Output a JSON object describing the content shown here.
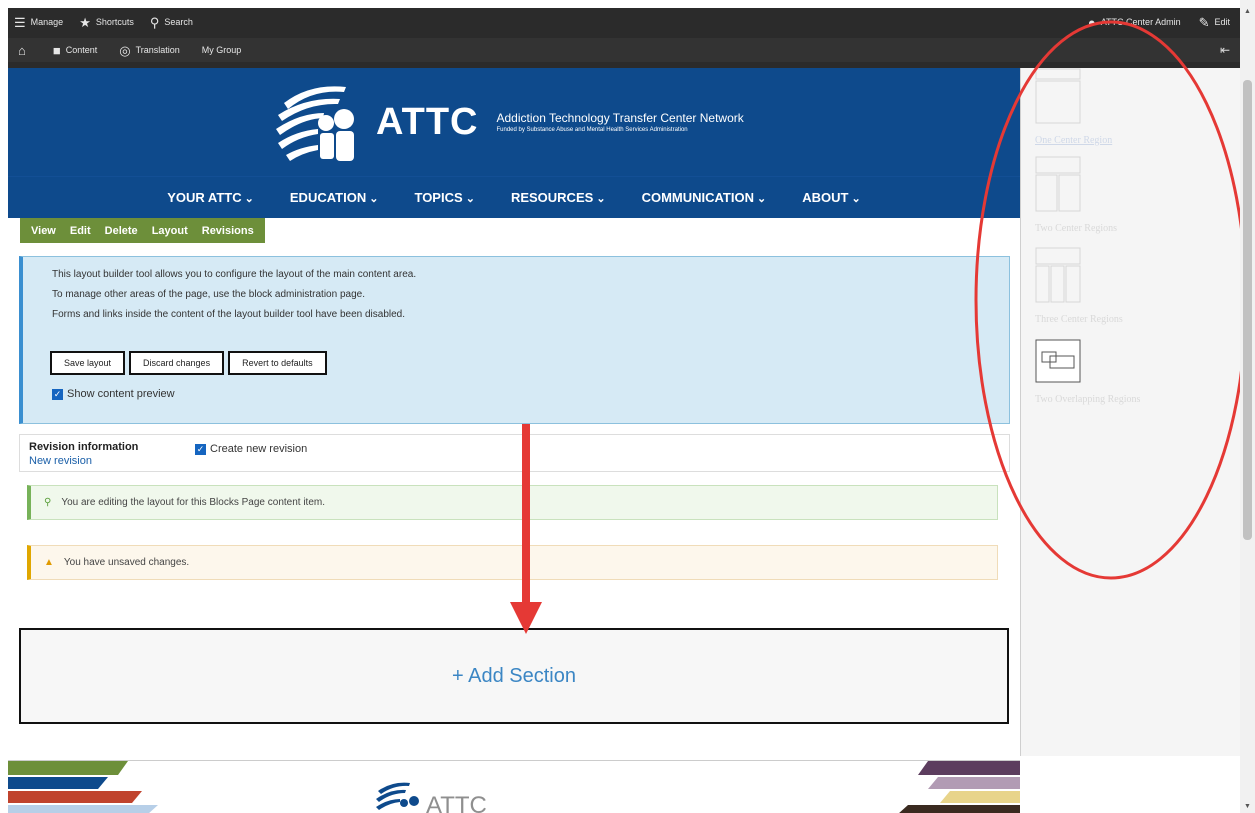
{
  "toolbar": {
    "manage": "Manage",
    "shortcuts": "Shortcuts",
    "search": "Search",
    "user": "ATTC Center Admin",
    "edit": "Edit",
    "content": "Content",
    "translation": "Translation",
    "my_group": "My Group"
  },
  "header": {
    "logo_text": "ATTC",
    "title": "Addiction Technology Transfer Center Network",
    "subtitle": "Funded by Substance Abuse and Mental Health Services Administration"
  },
  "nav": [
    "YOUR ATTC",
    "EDUCATION",
    "TOPICS",
    "RESOURCES",
    "COMMUNICATION",
    "ABOUT"
  ],
  "tabs": [
    "View",
    "Edit",
    "Delete",
    "Layout",
    "Revisions"
  ],
  "info": {
    "line1": "This layout builder tool allows you to configure the layout of the main content area.",
    "line2": "To manage other areas of the page, use the block administration page.",
    "line3": "Forms and links inside the content of the layout builder tool have been disabled.",
    "save": "Save layout",
    "discard": "Discard changes",
    "revert": "Revert to defaults",
    "preview": "Show content preview"
  },
  "revision": {
    "title": "Revision information",
    "link": "New revision",
    "checkbox": "Create new revision"
  },
  "messages": {
    "status": "You are editing the layout for this Blocks Page content item.",
    "warning": "You have unsaved changes."
  },
  "add_section": "+ Add Section",
  "footer": {
    "logo_text": "ATTC"
  },
  "offcanvas": {
    "layouts": [
      "One Center Region",
      "Two Center Regions",
      "Three Center Regions",
      "Two Overlapping Regions"
    ]
  },
  "colors": {
    "header_blue": "#0e4a8c",
    "tab_green": "#6d8f3a",
    "annotation_red": "#e53935",
    "link_blue": "#3b86c4"
  }
}
